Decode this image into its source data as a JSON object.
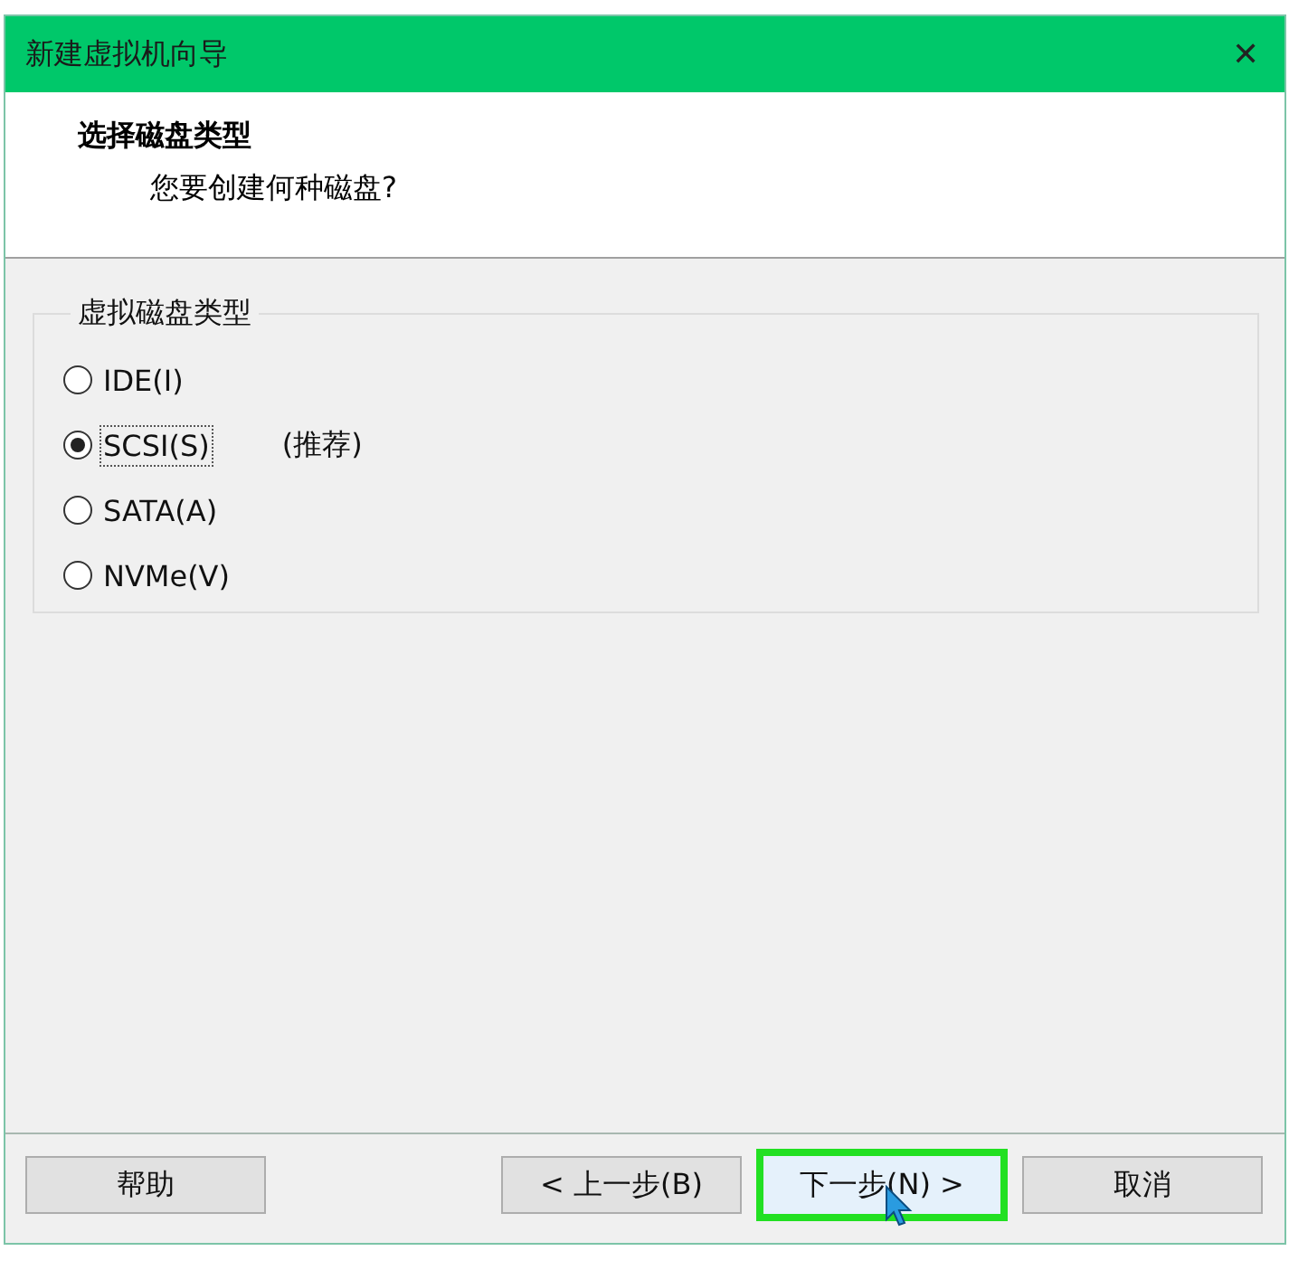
{
  "window": {
    "title": "新建虚拟机向导",
    "close": "✕"
  },
  "header": {
    "title": "选择磁盘类型",
    "subtitle": "您要创建何种磁盘?"
  },
  "group": {
    "label": "虚拟磁盘类型",
    "options": [
      {
        "label": "IDE(I)",
        "selected": false
      },
      {
        "label": "SCSI(S)",
        "selected": true,
        "note": "(推荐)"
      },
      {
        "label": "SATA(A)",
        "selected": false
      },
      {
        "label": "NVMe(V)",
        "selected": false
      }
    ]
  },
  "buttons": [
    {
      "label": "帮助",
      "kind": "help",
      "focused": false
    },
    {
      "label": "< 上一步(B)",
      "kind": "nav",
      "focused": false
    },
    {
      "label": "下一步(N) >",
      "kind": "nav",
      "focused": true
    },
    {
      "label": "取消",
      "kind": "nav",
      "focused": false
    }
  ]
}
